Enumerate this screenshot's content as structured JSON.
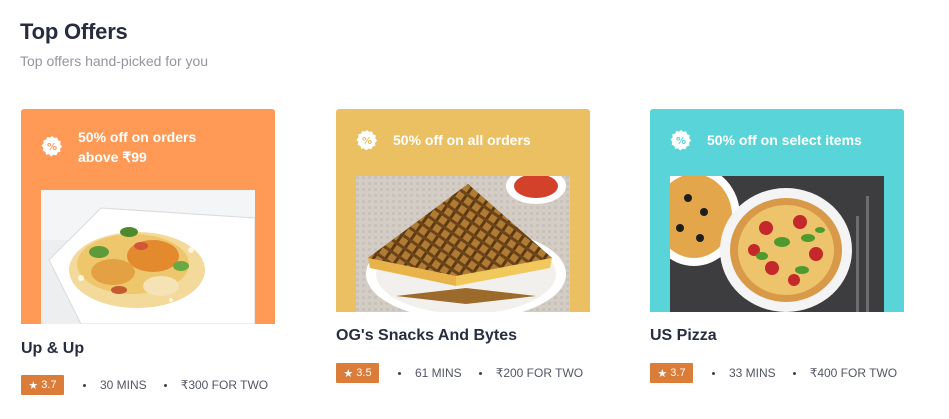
{
  "section": {
    "title": "Top Offers",
    "subtitle": "Top offers hand-picked for you"
  },
  "colors": {
    "card_0": "#fe9a56",
    "card_1": "#eac062",
    "card_2": "#59d4d8",
    "rating_badge": "#db7c38"
  },
  "offers": [
    {
      "offer_text": "50% off on orders above ₹99",
      "offer_icon": "percent-badge-icon",
      "image": "biryani-plate",
      "restaurant": "Up & Up",
      "rating": "3.7",
      "time": "30 MINS",
      "cost": "₹300 FOR TWO"
    },
    {
      "offer_text": "50% off on all orders",
      "offer_icon": "percent-badge-icon",
      "image": "grilled-sandwich",
      "restaurant": "OG's Snacks And Bytes",
      "rating": "3.5",
      "time": "61 MINS",
      "cost": "₹200 FOR TWO"
    },
    {
      "offer_text": "50% off on select items",
      "offer_icon": "percent-badge-icon",
      "image": "pizza",
      "restaurant": "US Pizza",
      "rating": "3.7",
      "time": "33 MINS",
      "cost": "₹400 FOR TWO"
    }
  ]
}
